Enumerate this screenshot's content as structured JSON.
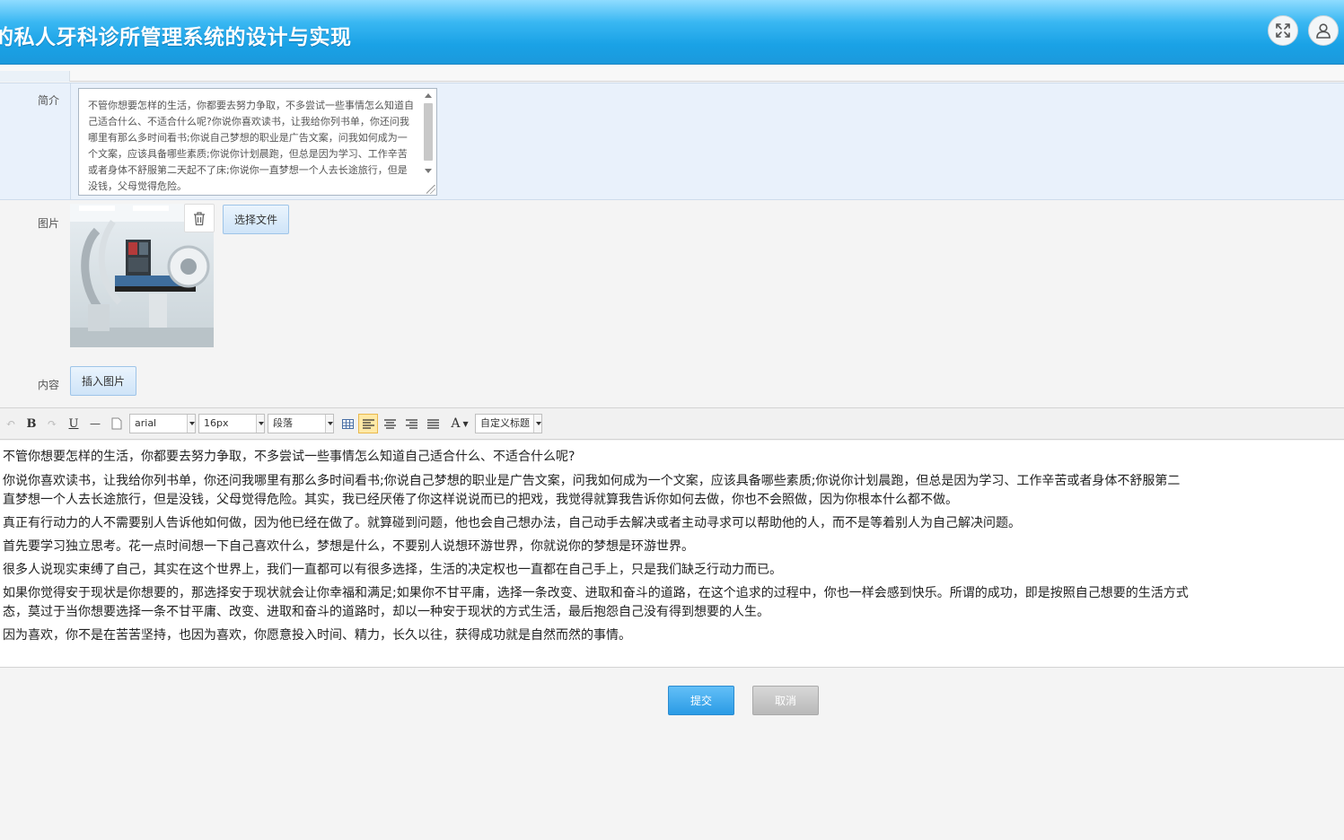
{
  "header": {
    "title": "的私人牙科诊所管理系统的设计与实现",
    "expand_icon": "expand-icon",
    "user_icon": "user-icon"
  },
  "form": {
    "intro_label": "简介",
    "intro_text": "不管你想要怎样的生活，你都要去努力争取，不多尝试一些事情怎么知道自己适合什么、不适合什么呢?你说你喜欢读书，让我给你列书单，你还问我哪里有那么多时间看书;你说自己梦想的职业是广告文案，问我如何成为一个文案，应该具备哪些素质;你说你计划晨跑，但总是因为学习、工作辛苦或者身体不舒服第二天起不了床;你说你一直梦想一个人去长途旅行，但是没钱，父母觉得危险。",
    "image_label": "图片",
    "choose_file_label": "选择文件",
    "content_label": "内容",
    "insert_image_label": "插入图片"
  },
  "toolbar": {
    "bold": "B",
    "underline": "U",
    "hr": "—",
    "font_family": "arial",
    "font_size": "16px",
    "paragraph": "段落",
    "font_color": "A",
    "custom_heading": "自定义标题"
  },
  "editor": {
    "paragraphs": [
      "不管你想要怎样的生活，你都要去努力争取，不多尝试一些事情怎么知道自己适合什么、不适合什么呢?",
      "你说你喜欢读书，让我给你列书单，你还问我哪里有那么多时间看书;你说自己梦想的职业是广告文案，问我如何成为一个文案，应该具备哪些素质;你说你计划晨跑，但总是因为学习、工作辛苦或者身体不舒服第二",
      "直梦想一个人去长途旅行，但是没钱，父母觉得危险。其实，我已经厌倦了你这样说说而已的把戏，我觉得就算我告诉你如何去做，你也不会照做，因为你根本什么都不做。",
      "真正有行动力的人不需要别人告诉他如何做，因为他已经在做了。就算碰到问题，他也会自己想办法，自己动手去解决或者主动寻求可以帮助他的人，而不是等着别人为自己解决问题。",
      "首先要学习独立思考。花一点时间想一下自己喜欢什么，梦想是什么，不要别人说想环游世界，你就说你的梦想是环游世界。",
      "很多人说现实束缚了自己，其实在这个世界上，我们一直都可以有很多选择，生活的决定权也一直都在自己手上，只是我们缺乏行动力而已。",
      "如果你觉得安于现状是你想要的，那选择安于现状就会让你幸福和满足;如果你不甘平庸，选择一条改变、进取和奋斗的道路，在这个追求的过程中，你也一样会感到快乐。所谓的成功，即是按照自己想要的生活方式",
      "态，莫过于当你想要选择一条不甘平庸、改变、进取和奋斗的道路时，却以一种安于现状的方式生活，最后抱怨自己没有得到想要的人生。",
      "因为喜欢，你不是在苦苦坚持，也因为喜欢，你愿意投入时间、精力，长久以往，获得成功就是自然而然的事情。"
    ]
  },
  "actions": {
    "submit_label": "提交",
    "cancel_label": "取消"
  },
  "colors": {
    "header_blue": "#1aa2e6",
    "submit_blue": "#2a9be5",
    "cancel_gray": "#b9b9b9"
  }
}
